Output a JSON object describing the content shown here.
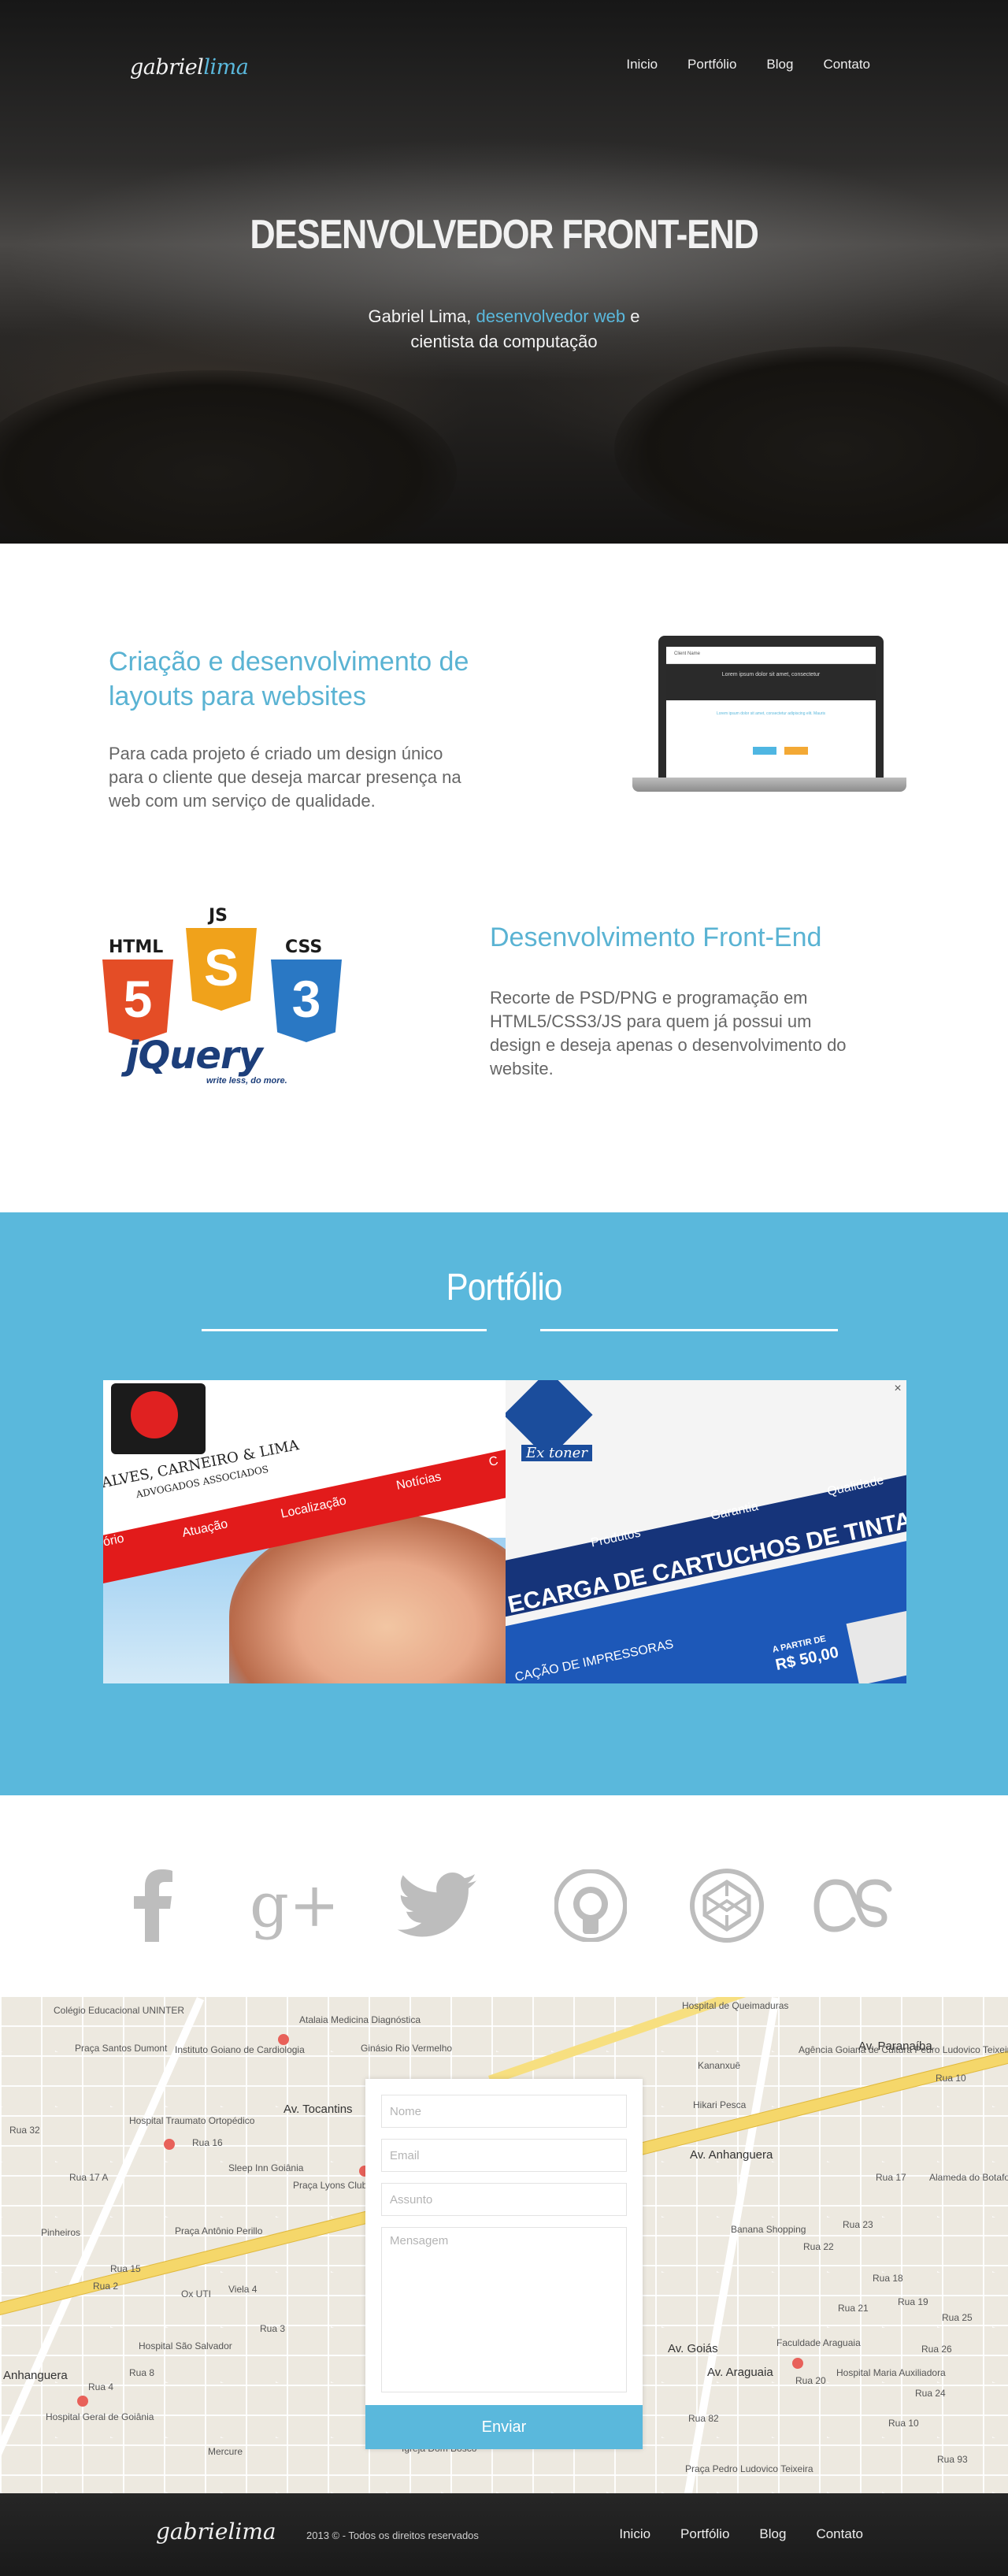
{
  "header": {
    "logo_main": "gabriel",
    "logo_accent": "lima",
    "nav": [
      "Inicio",
      "Portfólio",
      "Blog",
      "Contato"
    ]
  },
  "hero": {
    "title": "DESENVOLVEDOR FRONT-END",
    "subtitle_pre": "Gabriel Lima, ",
    "subtitle_highlight": "desenvolvedor web",
    "subtitle_post": " e",
    "subtitle_line2": "cientista da computação"
  },
  "services": [
    {
      "title_line1": "Criação e desenvolvimento de",
      "title_line2": "layouts para websites",
      "text": [
        "Para cada projeto é criado um design único",
        "para o cliente que deseja marcar presença na",
        "web com um serviço de qualidade."
      ]
    },
    {
      "title_line1": "Desenvolvimento Front-End",
      "text": [
        "Recorte de PSD/PNG e programação em",
        "HTML5/CSS3/JS para quem já possui um",
        "design e deseja apenas o desenvolvimento do",
        "website."
      ]
    }
  ],
  "tech": {
    "html": "HTML",
    "js": "JS",
    "css": "CSS",
    "html_num": "5",
    "js_num": "S",
    "css_num": "3",
    "jquery": "jQuery",
    "jquery_tag": "write less, do more."
  },
  "laptop": {
    "screen_logo": "Client Name",
    "screen_heading": "Lorem ipsum dolor sit amet, consectetur",
    "screen_text": "Lorem ipsum dolor sit amet, consectetur adipiscing elit. Mauris"
  },
  "portfolio": {
    "title": "Portfólio",
    "item1": {
      "name": "ALVES, CARNEIRO & LIMA",
      "subname": "ADVOGADOS ASSOCIADOS",
      "nav": [
        "ório",
        "Atuação",
        "Localização",
        "Notícias",
        "C"
      ]
    },
    "item2": {
      "logo": "Ex toner",
      "nav": [
        "Produtos",
        "Garantia",
        "Qualidade"
      ],
      "headline": "ECARGA DE CARTUCHOS DE TINTA E DE",
      "subline": "CAÇÃO DE IMPRESSORAS",
      "price_label": "A PARTIR DE",
      "price": "R$ 50,00"
    },
    "close": "×"
  },
  "social": [
    "facebook-icon",
    "google-plus-icon",
    "twitter-icon",
    "github-icon",
    "codepen-icon",
    "lastfm-icon"
  ],
  "map": {
    "labels": [
      "Hospital de Queimaduras",
      "Colégio Educacional UNINTER",
      "Atalaia Medicina Diagnóstica",
      "Praça Santos Dumont",
      "Instituto Goiano de Cardiologia",
      "Ginásio Rio Vermelho",
      "Agência Goiana de Cultura Pedro Ludovico Teixeira",
      "Kananxuê",
      "Hikari Pesca",
      "Hospital Traumato Ortopédico",
      "Sleep Inn Goiânia",
      "Praça Lyons Clube Internacional",
      "Pinheiros",
      "Praça Antônio Perillo",
      "Banana Shopping",
      "Av. Anhanguera",
      "Av. Paranaíba",
      "Hospital São Salvador",
      "Hospital Geral de Goiânia",
      "Mercure",
      "Igreja Dom Bosco",
      "Praça Pedro Ludovico Teixeira",
      "Faculdade Araguaia",
      "Hospital Maria Auxiliadora",
      "Alameda do Botafogo",
      "Av. Araguaia",
      "Av. Goiás",
      "Rua 24",
      "Rua 82",
      "Rua 10",
      "Av. Tocantins",
      "Rua 4",
      "Rua 2",
      "Rua 16",
      "Rua 20",
      "Rua 10",
      "Rua 93",
      "Rua 32",
      "Rua 17 A",
      "Rua 22",
      "Viela 4",
      "Ox UTI",
      "Rua 3",
      "Rua 8",
      "Rua 15",
      "Rua 17",
      "Rua 18",
      "Rua 19",
      "Rua 21",
      "Rua 23",
      "Rua 25",
      "Rua 26",
      "Anhanguera"
    ]
  },
  "form": {
    "name_placeholder": "Nome",
    "email_placeholder": "Email",
    "subject_placeholder": "Assunto",
    "message_placeholder": "Mensagem",
    "send_label": "Enviar"
  },
  "footer": {
    "logo": "gabrielima",
    "copyright": "2013 © - Todos os direitos reservados",
    "nav": [
      "Inicio",
      "Portfólio",
      "Blog",
      "Contato"
    ]
  },
  "colors": {
    "accent": "#5ab8dc",
    "service_title": "#5ab3d3",
    "footer_bg": "#1f1f1f"
  }
}
